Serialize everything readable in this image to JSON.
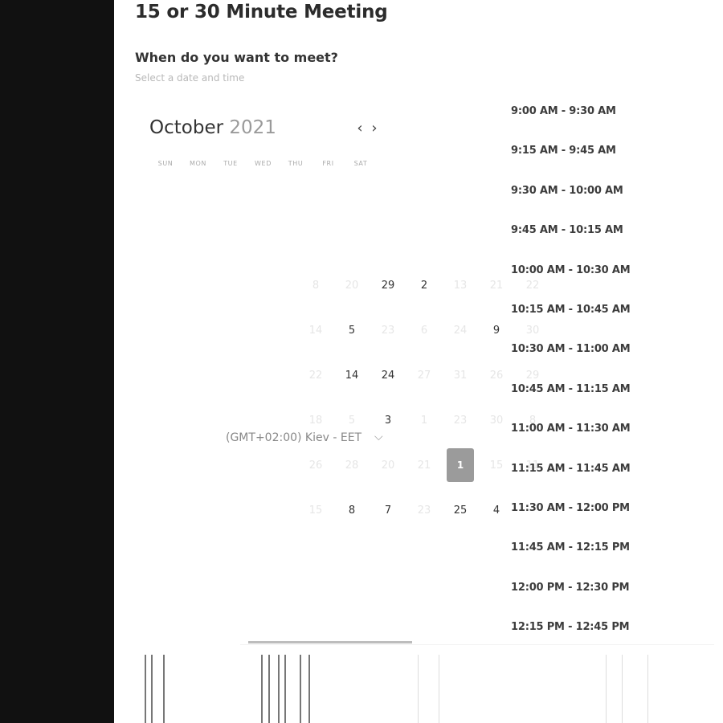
{
  "page": {
    "title": "15 or 30 Minute Meeting",
    "question": "When do you want to meet?",
    "hint": "Select a date and time"
  },
  "calendar": {
    "month": "October",
    "year": "2021",
    "prev_icon": "chevron-left-icon",
    "next_icon": "chevron-right-icon",
    "weekdays": [
      "SUN",
      "MON",
      "TUE",
      "WED",
      "THU",
      "FRI",
      "SAT"
    ],
    "days": [
      {
        "label": "8",
        "style": "faded"
      },
      {
        "label": "20",
        "style": "faded"
      },
      {
        "label": "29",
        "style": "normal"
      },
      {
        "label": "2",
        "style": "normal"
      },
      {
        "label": "13",
        "style": "faded"
      },
      {
        "label": "21",
        "style": "faded"
      },
      {
        "label": "22",
        "style": "faded"
      },
      {
        "label": "14",
        "style": "faded"
      },
      {
        "label": "5",
        "style": "normal"
      },
      {
        "label": "23",
        "style": "faded"
      },
      {
        "label": "6",
        "style": "faded"
      },
      {
        "label": "24",
        "style": "faded"
      },
      {
        "label": "9",
        "style": "normal"
      },
      {
        "label": "30",
        "style": "faded"
      },
      {
        "label": "22",
        "style": "faded"
      },
      {
        "label": "14",
        "style": "normal"
      },
      {
        "label": "24",
        "style": "normal"
      },
      {
        "label": "27",
        "style": "faded"
      },
      {
        "label": "31",
        "style": "faded"
      },
      {
        "label": "26",
        "style": "faded"
      },
      {
        "label": "29",
        "style": "faded"
      },
      {
        "label": "18",
        "style": "faded"
      },
      {
        "label": "5",
        "style": "faded"
      },
      {
        "label": "3",
        "style": "normal"
      },
      {
        "label": "1",
        "style": "faded"
      },
      {
        "label": "23",
        "style": "faded"
      },
      {
        "label": "30",
        "style": "faded"
      },
      {
        "label": "8",
        "style": "faded"
      },
      {
        "label": "26",
        "style": "faded"
      },
      {
        "label": "28",
        "style": "faded"
      },
      {
        "label": "20",
        "style": "faded"
      },
      {
        "label": "21",
        "style": "faded"
      },
      {
        "label": "1",
        "style": "selected"
      },
      {
        "label": "15",
        "style": "faded"
      },
      {
        "label": "11",
        "style": "faded"
      },
      {
        "label": "15",
        "style": "faded"
      },
      {
        "label": "8",
        "style": "normal"
      },
      {
        "label": "7",
        "style": "normal"
      },
      {
        "label": "23",
        "style": "faded"
      },
      {
        "label": "25",
        "style": "normal"
      },
      {
        "label": "4",
        "style": "normal"
      }
    ]
  },
  "timezone": {
    "label": "(GMT+02:00) Kiev - EET",
    "chevron_icon": "chevron-down-icon"
  },
  "slots": [
    "9:00 AM - 9:30 AM",
    "9:15 AM - 9:45 AM",
    "9:30 AM - 10:00 AM",
    "9:45 AM - 10:15 AM",
    "10:00 AM - 10:30 AM",
    "10:15 AM - 10:45 AM",
    "10:30 AM - 11:00 AM",
    "10:45 AM - 11:15 AM",
    "11:00 AM - 11:30 AM",
    "11:15 AM - 11:45 AM",
    "11:30 AM - 12:00 PM",
    "11:45 AM - 12:15 PM",
    "12:00 PM - 12:30 PM",
    "12:15 PM - 12:45 PM"
  ],
  "colors": {
    "sidebar": "#111111",
    "selected_day": "#9b9b9b",
    "text": "#333333"
  }
}
